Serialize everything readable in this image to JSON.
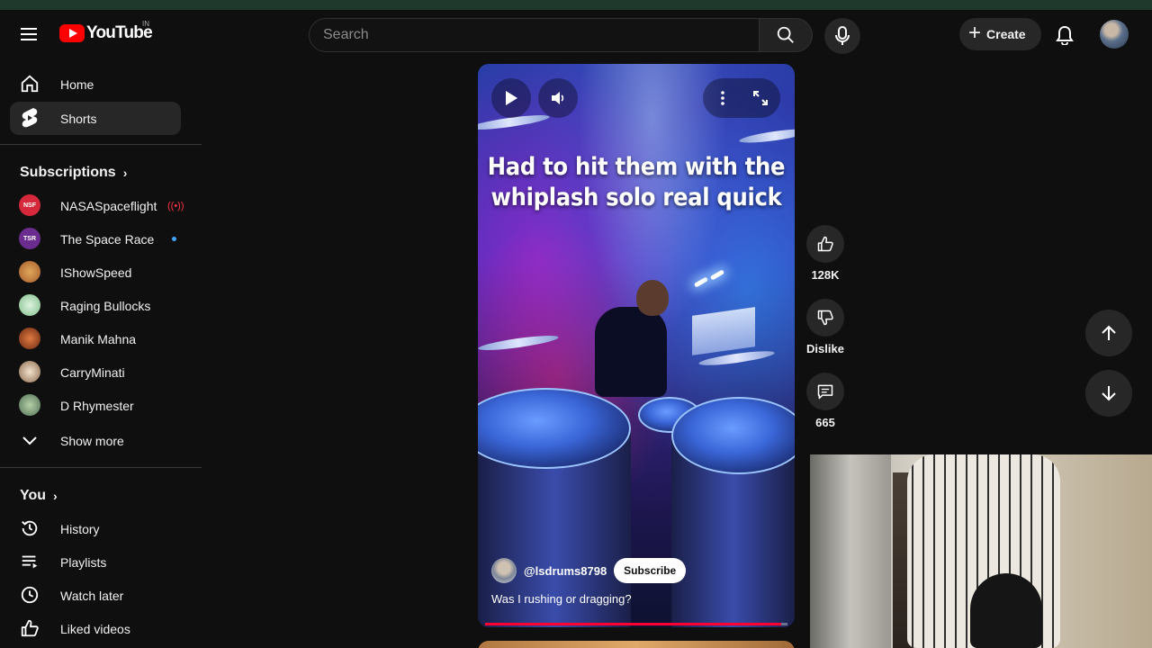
{
  "header": {
    "logo_text": "YouTube",
    "logo_region": "IN",
    "search_placeholder": "Search",
    "create_label": "Create"
  },
  "sidebar": {
    "main": [
      {
        "label": "Home",
        "icon": "home-icon"
      },
      {
        "label": "Shorts",
        "icon": "shorts-icon",
        "active": true
      }
    ],
    "subscriptions_title": "Subscriptions",
    "subscriptions": [
      {
        "label": "NASASpaceflight",
        "avatar_text": "NSF",
        "color": "#d6283b",
        "indicator": "live"
      },
      {
        "label": "The Space Race",
        "avatar_text": "TSR",
        "color": "#6b2c8f",
        "indicator": "new"
      },
      {
        "label": "IShowSpeed",
        "avatar_text": "",
        "color": "#c98a3a"
      },
      {
        "label": "Raging Bullocks",
        "avatar_text": "",
        "color": "#9fcfa5"
      },
      {
        "label": "Manik Mahna",
        "avatar_text": "",
        "color": "#b8532b"
      },
      {
        "label": "CarryMinati",
        "avatar_text": "",
        "color": "#e8d7c4"
      },
      {
        "label": "D Rhymester",
        "avatar_text": "",
        "color": "#7aa17d"
      }
    ],
    "show_more_label": "Show more",
    "you_title": "You",
    "you_items": [
      {
        "label": "History",
        "icon": "history-icon"
      },
      {
        "label": "Playlists",
        "icon": "playlists-icon"
      },
      {
        "label": "Watch later",
        "icon": "watch-later-icon"
      },
      {
        "label": "Liked videos",
        "icon": "liked-videos-icon"
      }
    ]
  },
  "short": {
    "overlay_text_line1": "Had to hit them with the",
    "overlay_text_line2": "whiplash solo real quick",
    "channel": "@lsdrums8798",
    "subscribe_label": "Subscribe",
    "title": "Was I rushing or dragging?",
    "progress": 0.98
  },
  "actions": {
    "likes": "128K",
    "dislike_label": "Dislike",
    "comments": "665"
  },
  "colors": {
    "accent_red": "#ff0000",
    "background": "#0f0f0f",
    "surface": "#272727"
  }
}
